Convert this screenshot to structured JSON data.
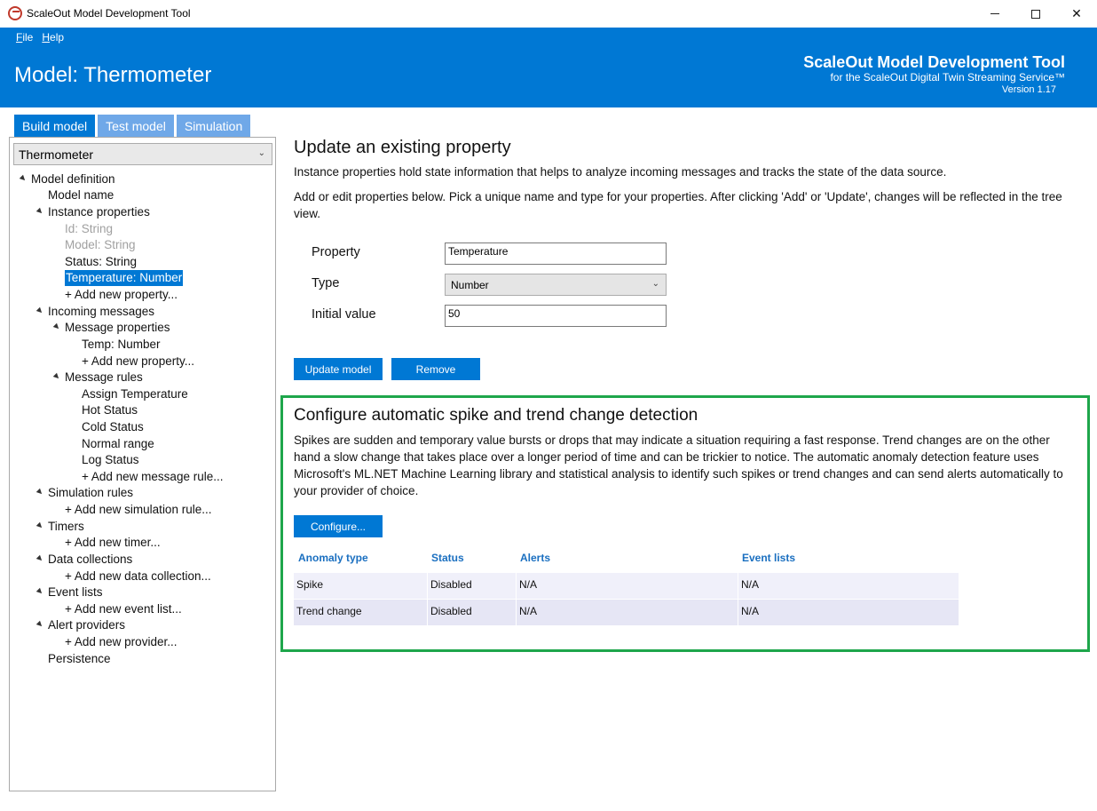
{
  "window": {
    "title": "ScaleOut Model Development Tool"
  },
  "menu": {
    "file": "File",
    "help": "Help"
  },
  "header": {
    "model_title": "Model: Thermometer",
    "brand_title": "ScaleOut Model Development Tool",
    "brand_subtitle": "for the ScaleOut Digital Twin Streaming Service™",
    "version": "Version 1.17"
  },
  "tabs": [
    {
      "label": "Build model",
      "active": true
    },
    {
      "label": "Test model",
      "active": false
    },
    {
      "label": "Simulation",
      "active": false
    }
  ],
  "model_select": {
    "value": "Thermometer"
  },
  "tree": {
    "model_definition": "Model definition",
    "model_name": "Model name",
    "instance_properties": "Instance properties",
    "id": "Id: String",
    "model": "Model: String",
    "status": "Status: String",
    "temperature": "Temperature: Number",
    "add_property": "+ Add new property...",
    "incoming_messages": "Incoming messages",
    "message_properties": "Message properties",
    "temp": "Temp: Number",
    "add_msg_property": "+ Add new property...",
    "message_rules": "Message rules",
    "rule_assign": "Assign Temperature",
    "rule_hot": "Hot Status",
    "rule_cold": "Cold Status",
    "rule_normal": "Normal range",
    "rule_log": "Log Status",
    "add_rule": "+ Add new message rule...",
    "simulation_rules": "Simulation rules",
    "add_sim_rule": "+ Add new simulation rule...",
    "timers": "Timers",
    "add_timer": "+ Add new timer...",
    "data_collections": "Data collections",
    "add_data_collection": "+ Add new data collection...",
    "event_lists": "Event lists",
    "add_event_list": "+ Add new event list...",
    "alert_providers": "Alert providers",
    "add_provider": "+ Add new provider...",
    "persistence": "Persistence"
  },
  "property_editor": {
    "heading": "Update an existing property",
    "desc1": "Instance properties hold state information that helps to analyze incoming messages and tracks the state of the data source.",
    "desc2": "Add or edit properties below. Pick a unique name and type for your properties. After clicking 'Add' or 'Update', changes will be reflected in the tree view.",
    "property_label": "Property",
    "property_value": "Temperature",
    "type_label": "Type",
    "type_value": "Number",
    "initial_label": "Initial value",
    "initial_value": "50",
    "update_button": "Update model",
    "remove_button": "Remove"
  },
  "anomaly": {
    "heading": "Configure automatic spike and trend change detection",
    "desc": "Spikes are sudden and temporary value bursts or drops that may indicate a situation requiring a fast response. Trend changes are on the other hand a slow change that takes place over a longer period of time and can be trickier to notice. The automatic anomaly detection feature uses Microsoft's ML.NET Machine Learning library and statistical analysis to identify such spikes or trend changes and can send alerts automatically to your provider of choice.",
    "configure_button": "Configure...",
    "columns": [
      "Anomaly type",
      "Status",
      "Alerts",
      "Event lists"
    ],
    "rows": [
      [
        "Spike",
        "Disabled",
        "N/A",
        "N/A"
      ],
      [
        "Trend change",
        "Disabled",
        "N/A",
        "N/A"
      ]
    ]
  }
}
